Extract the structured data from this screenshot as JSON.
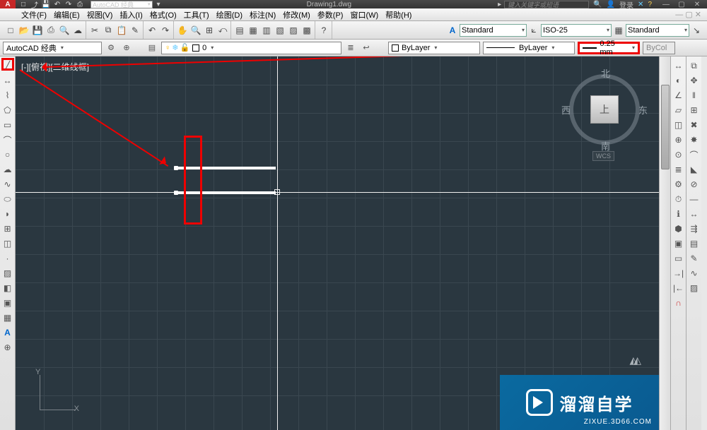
{
  "title": "Drawing1.dwg",
  "search_placeholder": "键入关键字或短语",
  "user": {
    "login": "登录"
  },
  "qat_icons": [
    "new",
    "open",
    "save",
    "undo",
    "redo",
    "print"
  ],
  "workspace_qat": "AutoCAD 经典",
  "menus": [
    "文件(F)",
    "编辑(E)",
    "视图(V)",
    "插入(I)",
    "格式(O)",
    "工具(T)",
    "绘图(D)",
    "标注(N)",
    "修改(M)",
    "参数(P)",
    "窗口(W)",
    "帮助(H)"
  ],
  "toolbar1": {
    "textstyle": "Standard",
    "dimstyle": "ISO-25",
    "tablestyle": "Standard"
  },
  "toolbar2": {
    "workspace": "AutoCAD 经典",
    "layer": "0",
    "color": "ByLayer",
    "linetype": "ByLayer",
    "lineweight": "0.25 mm",
    "plotstyle": "ByCol"
  },
  "viewport_label": "[-][俯视][二维线框]",
  "viewcube": {
    "top": "上",
    "n": "北",
    "s": "南",
    "e": "东",
    "w": "西",
    "wcs": "WCS"
  },
  "ucs": {
    "x": "X",
    "y": "Y"
  },
  "left_tools": [
    "line",
    "xline",
    "pline",
    "polygon",
    "rect",
    "arc",
    "circle",
    "revcloud",
    "spline",
    "ellipse",
    "ellipse-arc",
    "insert",
    "block",
    "point",
    "hatch",
    "gradient",
    "region",
    "table",
    "mtext",
    "addsel"
  ],
  "right_tools_a": [
    "dist",
    "radius",
    "angle",
    "area",
    "volume",
    "quick",
    "id",
    "list",
    "setvar",
    "time",
    "status",
    "massprop",
    "region2",
    "boundary",
    "extend",
    "trim",
    "stretch",
    "rotate",
    "scale",
    "mirror"
  ],
  "right_tools_b": [
    "copy",
    "move",
    "offset",
    "array",
    "erase",
    "explode",
    "fillet",
    "chamfer",
    "break",
    "join",
    "lengthen",
    "align",
    "draworder",
    "pedit",
    "splinedit",
    "hatchedit",
    "mtextedit",
    "ddedit",
    "properties",
    "matchprop"
  ],
  "watermark": {
    "brand": "溜溜自学",
    "url": "ZIXUE.3D66.COM"
  }
}
